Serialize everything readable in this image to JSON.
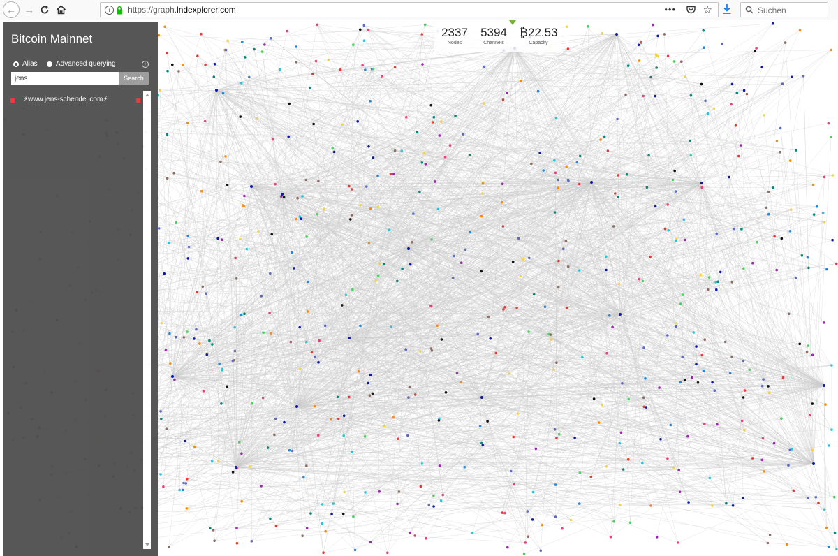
{
  "browser": {
    "url_prefix": "https://graph.",
    "url_host": "lndexplorer.com",
    "page_actions": "•••",
    "search_placeholder": "Suchen"
  },
  "sidebar": {
    "title": "Bitcoin Mainnet",
    "radio_alias": "Alias",
    "radio_advanced": "Advanced querying",
    "search_value": "jens",
    "search_button": "Search",
    "result_text": "⚡www.jens-schendel.com⚡"
  },
  "stats": {
    "nodes": {
      "value": "2337",
      "label": "Nodes"
    },
    "channels": {
      "value": "5394",
      "label": "Channels"
    },
    "capacity": {
      "value": "₿22.53",
      "label": "Capacity"
    }
  },
  "colors": {
    "graph_edge": "#cccccc",
    "result_marker": "#e53935",
    "node_palette": [
      "#e53935",
      "#1e88e5",
      "#43d65c",
      "#111111",
      "#0d1aa8",
      "#f5d442",
      "#fb8c00",
      "#9c27b0",
      "#26c6da",
      "#5c6bc0",
      "#00897b",
      "#ec407a",
      "#8d6e63"
    ]
  }
}
